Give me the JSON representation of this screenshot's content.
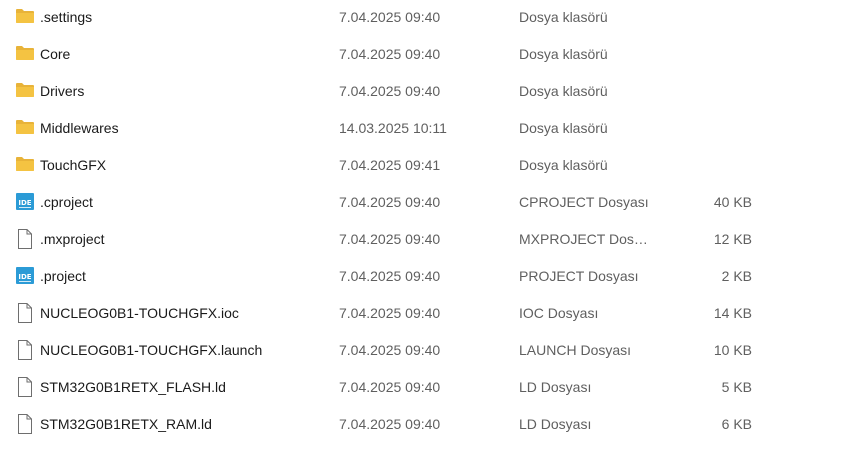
{
  "files": [
    {
      "name": ".settings",
      "date": "7.04.2025 09:40",
      "type": "Dosya klasörü",
      "size": "",
      "icon": "folder-icon"
    },
    {
      "name": "Core",
      "date": "7.04.2025 09:40",
      "type": "Dosya klasörü",
      "size": "",
      "icon": "folder-icon"
    },
    {
      "name": "Drivers",
      "date": "7.04.2025 09:40",
      "type": "Dosya klasörü",
      "size": "",
      "icon": "folder-icon"
    },
    {
      "name": "Middlewares",
      "date": "14.03.2025 10:11",
      "type": "Dosya klasörü",
      "size": "",
      "icon": "folder-icon"
    },
    {
      "name": "TouchGFX",
      "date": "7.04.2025 09:41",
      "type": "Dosya klasörü",
      "size": "",
      "icon": "folder-icon"
    },
    {
      "name": ".cproject",
      "date": "7.04.2025 09:40",
      "type": "CPROJECT Dosyası",
      "size": "40 KB",
      "icon": "ide-file-icon"
    },
    {
      "name": ".mxproject",
      "date": "7.04.2025 09:40",
      "type": "MXPROJECT Dosy...",
      "size": "12 KB",
      "icon": "file-icon"
    },
    {
      "name": ".project",
      "date": "7.04.2025 09:40",
      "type": "PROJECT Dosyası",
      "size": "2 KB",
      "icon": "ide-file-icon"
    },
    {
      "name": "NUCLEOG0B1-TOUCHGFX.ioc",
      "date": "7.04.2025 09:40",
      "type": "IOC Dosyası",
      "size": "14 KB",
      "icon": "file-icon"
    },
    {
      "name": "NUCLEOG0B1-TOUCHGFX.launch",
      "date": "7.04.2025 09:40",
      "type": "LAUNCH Dosyası",
      "size": "10 KB",
      "icon": "file-icon"
    },
    {
      "name": "STM32G0B1RETX_FLASH.ld",
      "date": "7.04.2025 09:40",
      "type": "LD Dosyası",
      "size": "5 KB",
      "icon": "file-icon"
    },
    {
      "name": "STM32G0B1RETX_RAM.ld",
      "date": "7.04.2025 09:40",
      "type": "LD Dosyası",
      "size": "6 KB",
      "icon": "file-icon"
    }
  ],
  "colors": {
    "folder": "#f4c342",
    "folder_tab": "#e8b339",
    "ide_icon": "#2b9bd6",
    "file_outline": "#6e6e6e",
    "secondary_text": "#5f5f5f"
  }
}
